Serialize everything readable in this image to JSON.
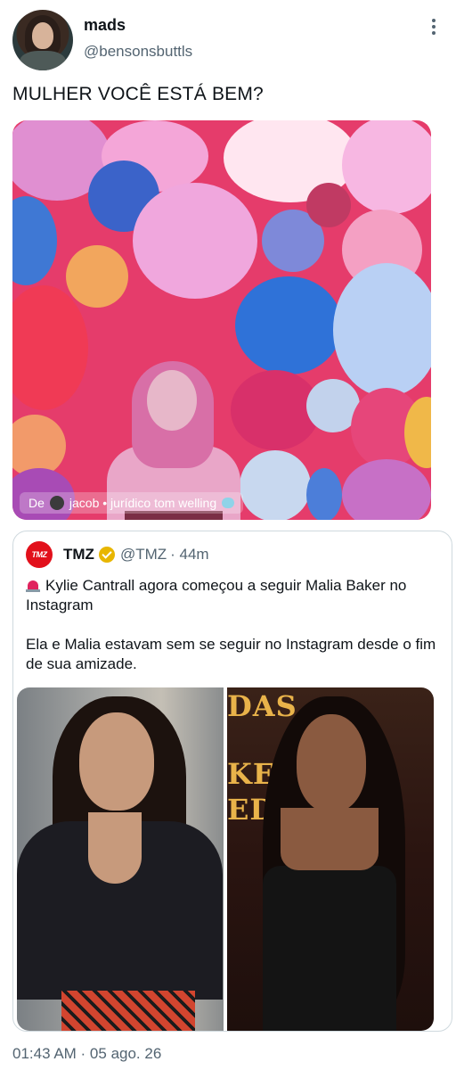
{
  "tweet": {
    "author_name": "mads",
    "author_handle": "@bensonsbuttls",
    "text": "MULHER VOCÊ ESTÁ BEM?",
    "media_attribution": {
      "prefix": "De",
      "source": "jacob • jurídico tom welling",
      "emoji_icon": "brain-icon"
    },
    "timestamp": "01:43 AM · 05 ago. 26"
  },
  "quoted_tweet": {
    "author_name": "TMZ",
    "author_handle": "@TMZ",
    "time_ago": "· 44m",
    "logo_text": "TMZ",
    "line1": "Kylie Cantrall agora começou a seguir Malia Baker no Instagram",
    "line2": "Ela e Malia estavam sem se seguir no Instagram desde o fim de sua amizade.",
    "poster_text_1": "DAS",
    "poster_text_2": "KE",
    "poster_text_3": "ED"
  },
  "colors": {
    "text_primary": "#0f1419",
    "text_secondary": "#536471",
    "border": "#cfd9de",
    "verified": "#e8b600",
    "tmz_red": "#e2101b"
  }
}
